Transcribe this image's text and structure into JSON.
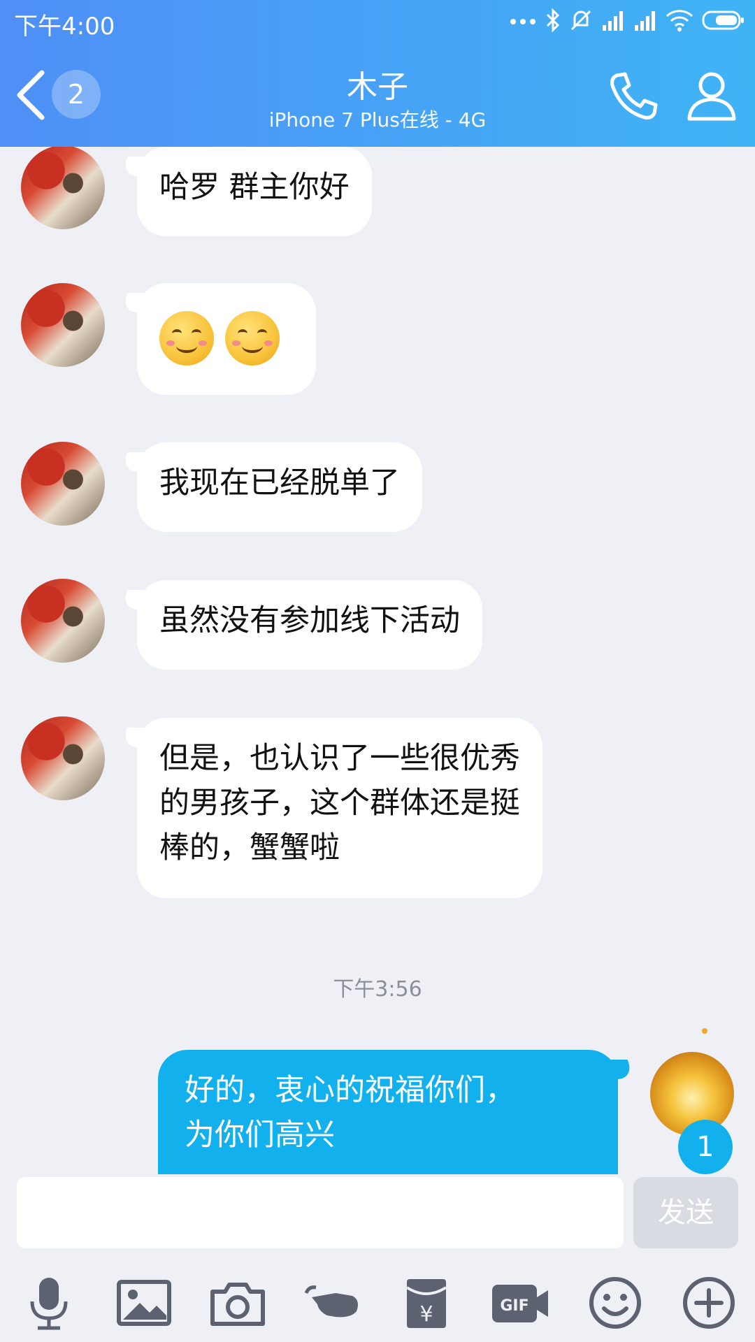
{
  "status_bar": {
    "time": "下午4:00",
    "icons": [
      "more-dots-icon",
      "bluetooth-icon",
      "silent-icon",
      "signal-icon",
      "signal-icon",
      "wifi-icon",
      "battery-icon"
    ]
  },
  "header": {
    "unread_count": "2",
    "title": "木子",
    "subtitle": "iPhone 7 Plus在线 - 4G"
  },
  "messages": [
    {
      "sender": "friend",
      "text": "哈罗 群主你好"
    },
    {
      "sender": "friend",
      "emojis": [
        "smile-emoji",
        "smile-emoji"
      ]
    },
    {
      "sender": "friend",
      "text": "我现在已经脱单了"
    },
    {
      "sender": "friend",
      "text": "虽然没有参加线下活动"
    },
    {
      "sender": "friend",
      "lines": [
        "但是，也认识了一些很优秀",
        "的男孩子，这个群体还是挺",
        "棒的，蟹蟹啦"
      ]
    }
  ],
  "timestamp": "下午3:56",
  "outgoing": {
    "lines": [
      "好的，衷心的祝福你们，",
      "为你们高兴"
    ],
    "new_badge": "1"
  },
  "input": {
    "value": "",
    "placeholder": "",
    "send_label": "发送"
  },
  "toolbar_icons": [
    "microphone-icon",
    "image-icon",
    "camera-icon",
    "poke-icon",
    "red-packet-icon",
    "gif-icon",
    "emoji-icon",
    "plus-icon"
  ],
  "colors": {
    "header_start": "#4f8ff6",
    "header_end": "#3fb4f5",
    "outgoing_bubble": "#12b1ee",
    "background": "#eef0f6"
  }
}
